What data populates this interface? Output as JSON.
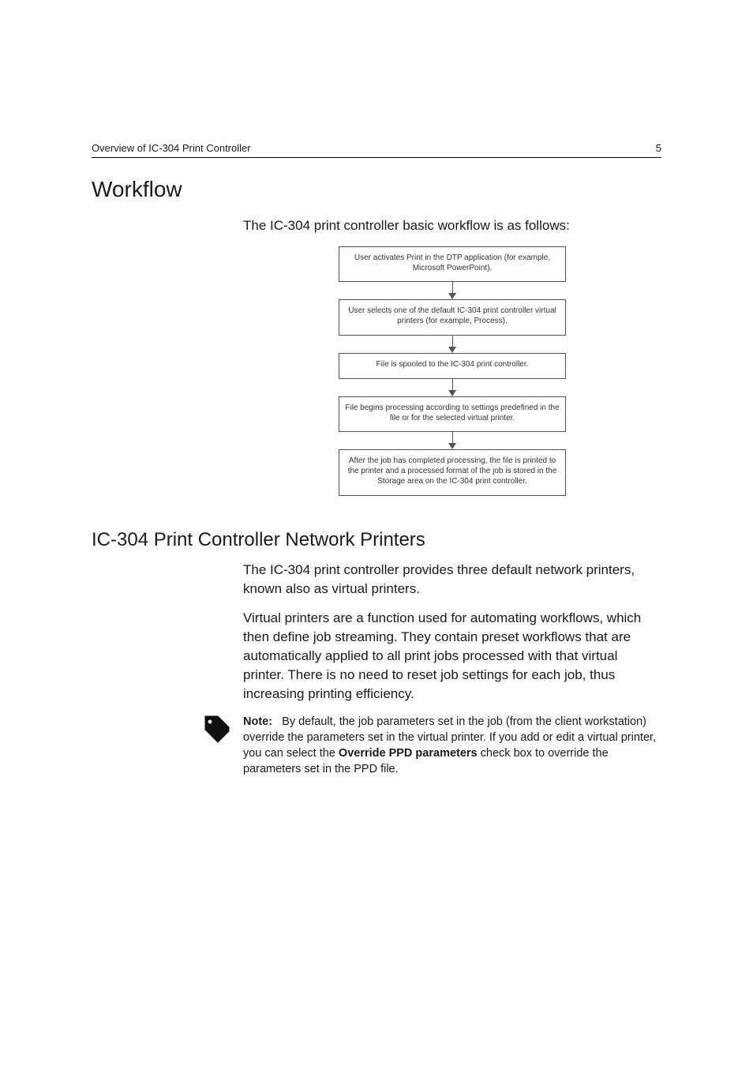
{
  "header": {
    "running_title": "Overview of IC-304 Print Controller",
    "page_number": "5"
  },
  "section1": {
    "heading": "Workflow",
    "intro": "The IC-304 print controller basic workflow is as follows:"
  },
  "flow": {
    "b1": "User activates Print in the DTP application (for example, Microsoft PowerPoint).",
    "b2": "User selects one of the default IC-304 print controller virtual printers (for example, Process).",
    "b3": "File is spooled to the IC-304 print controller.",
    "b4": "File begins processing according to settings predefined in the file or for the selected virtual printer.",
    "b5": "After the job has completed processing, the file is printed to the printer and a processed format of the job is stored in the Storage area on the IC-304 print controller."
  },
  "section2": {
    "heading": "IC-304 Print Controller Network Printers",
    "p1": "The IC-304 print controller provides three default network printers, known also as virtual printers.",
    "p2": "Virtual printers are a function used for automating workflows, which then define job streaming. They contain preset workflows that are automatically applied to all print jobs processed with that virtual printer. There is no need to reset job settings for each job, thus increasing printing efficiency.",
    "note_label": "Note:",
    "note_before": "By default, the job parameters set in the job (from the client workstation) override the parameters set in the virtual printer. If you add or edit a virtual printer, you can select the ",
    "note_bold": "Override PPD parameters",
    "note_after": " check box to override the parameters set in the PPD file."
  }
}
